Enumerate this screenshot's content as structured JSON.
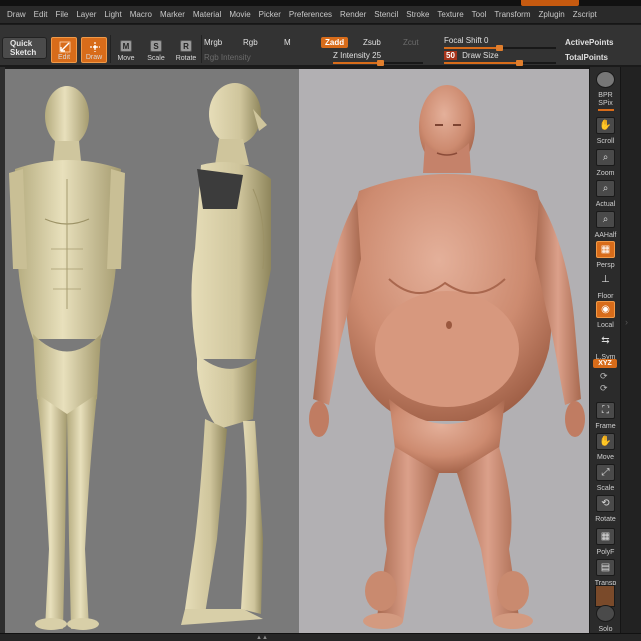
{
  "menu": [
    "Draw",
    "Edit",
    "File",
    "Layer",
    "Light",
    "Macro",
    "Marker",
    "Material",
    "Movie",
    "Picker",
    "Preferences",
    "Render",
    "Stencil",
    "Stroke",
    "Texture",
    "Tool",
    "Transform",
    "Zplugin",
    "Zscript"
  ],
  "toolbar": {
    "quick_sketch": [
      "Quick",
      "Sketch"
    ],
    "edit_label": "Edit",
    "draw_label": "Draw",
    "move_label": "Move",
    "scale_label": "Scale",
    "rotate_label": "Rotate",
    "move_key": "M",
    "scale_key": "S",
    "rotate_key": "R",
    "mrgb": "Mrgb",
    "rgb": "Rgb",
    "m": "M",
    "rgb_intensity": "Rgb Intensity",
    "zadd": "Zadd",
    "zsub": "Zsub",
    "zcut": "Zcut",
    "z_intensity_label": "Z Intensity",
    "z_intensity_value": "25",
    "focal_shift_label": "Focal Shift",
    "focal_shift_value": "0",
    "draw_size_label": "Draw Size",
    "draw_size_value": "50",
    "active_points": "ActivePoints",
    "total_points": "TotalPoints"
  },
  "shelf": {
    "bpr": "BPR",
    "spix": "SPix",
    "scroll": "Scroll",
    "zoom": "Zoom",
    "actual": "Actual",
    "aahalf": "AAHalf",
    "persp": "Persp",
    "floor": "Floor",
    "local": "Local",
    "lsym": "L.Sym",
    "xyz": "XYZ",
    "frame": "Frame",
    "move": "Move",
    "scale": "Scale",
    "rotate": "Rotate",
    "polyf": "PolyF",
    "transp": "Transp",
    "solo": "Solo"
  },
  "colors": {
    "accent": "#d86c1a",
    "left_bg": "#7a7a7a",
    "right_bg": "#b2b0b3",
    "clay_light": "#e4dcb8",
    "clay_dark": "#9c9266",
    "skin_light": "#dca48a",
    "skin_dark": "#9e5e45"
  },
  "icons": [
    "edit-icon",
    "draw-icon",
    "move-icon",
    "scale-icon",
    "rotate-icon",
    "bpr-icon",
    "scroll-icon",
    "zoom-icon",
    "actual-icon",
    "aahalf-icon",
    "persp-icon",
    "floor-icon",
    "local-icon",
    "lsym-icon",
    "frame-icon",
    "move-view-icon",
    "scale-view-icon",
    "rotate-view-icon",
    "polyf-icon",
    "transp-icon",
    "solo-icon"
  ]
}
